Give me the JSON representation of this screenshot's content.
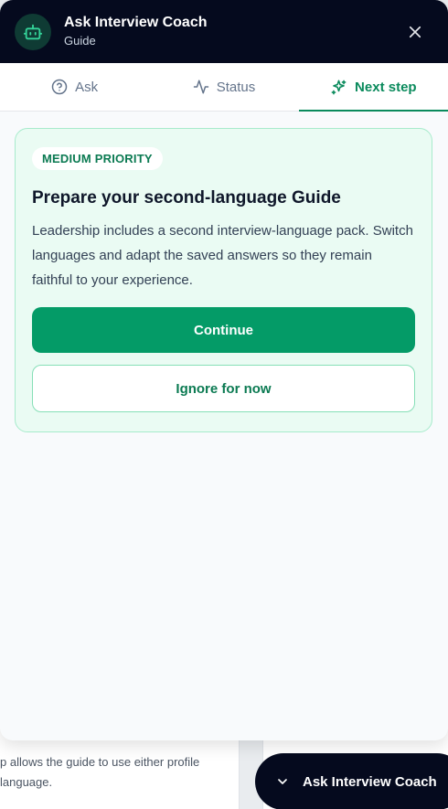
{
  "header": {
    "title": "Ask Interview Coach",
    "subtitle": "Guide"
  },
  "tabs": [
    {
      "label": "Ask",
      "icon": "help-circle-icon",
      "active": false
    },
    {
      "label": "Status",
      "icon": "activity-icon",
      "active": false
    },
    {
      "label": "Next step",
      "icon": "sparkle-icon",
      "active": true
    }
  ],
  "card": {
    "badge": "MEDIUM PRIORITY",
    "title": "Prepare your second-language Guide",
    "body": "Leadership includes a second interview-language pack. Switch languages and adapt the saved answers so they remain faithful to your experience.",
    "primary_label": "Continue",
    "secondary_label": "Ignore for now"
  },
  "background": {
    "text": "p allows the guide to use either profile\nlanguage."
  },
  "fab": {
    "label": "Ask Interview Coach",
    "icon": "chevron-down-icon"
  },
  "colors": {
    "header_bg": "#050a1e",
    "accent": "#049b67",
    "accent_text": "#0b7a52",
    "card_bg": "#eafbf3"
  }
}
